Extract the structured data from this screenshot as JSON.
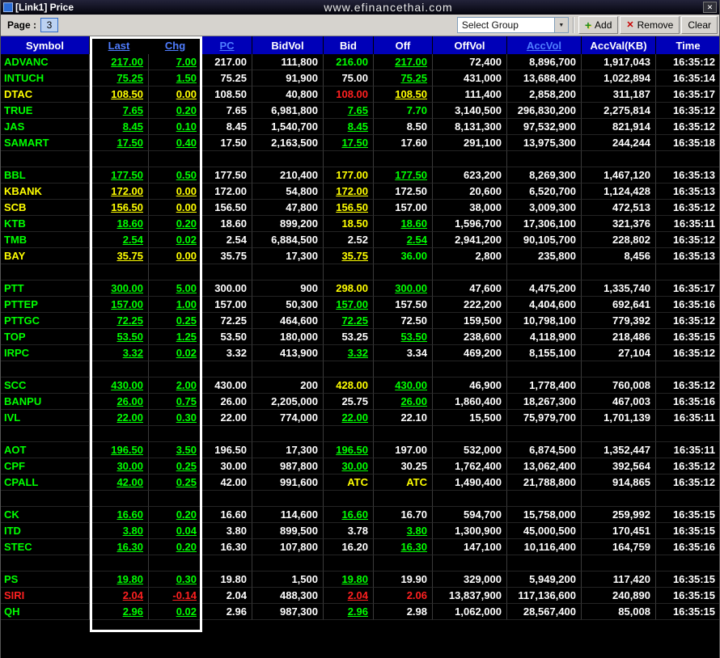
{
  "window": {
    "title": "[Link1] Price",
    "url": "www.efinancethai.com"
  },
  "icons": {
    "close": "✕",
    "dropdown": "▼",
    "add": "+",
    "remove": "✕"
  },
  "toolbar": {
    "page_label": "Page :",
    "page_value": "3",
    "group_placeholder": "Select Group",
    "add_label": "Add",
    "remove_label": "Remove",
    "clear_label": "Clear"
  },
  "colors": {
    "up": "#00ff00",
    "unchanged": "#ffff00",
    "down": "#ff2020",
    "header_bg": "#0000b8",
    "header_link": "#4f7dff"
  },
  "table": {
    "columns": [
      "Symbol",
      "Last",
      "Chg",
      "PC",
      "BidVol",
      "Bid",
      "Off",
      "OffVol",
      "AccVol",
      "AccVal(KB)",
      "Time"
    ],
    "rows": [
      {
        "symbol": "ADVANC",
        "trend": "up",
        "last": "217.00",
        "chg": "7.00",
        "pc": "217.00",
        "bidvol": "111,800",
        "bid": "216.00",
        "bid_c": "up",
        "bid_u": false,
        "off": "217.00",
        "off_c": "up",
        "off_u": true,
        "offvol": "72,400",
        "accvol": "8,896,700",
        "accval": "1,917,043",
        "time": "16:35:12"
      },
      {
        "symbol": "INTUCH",
        "trend": "up",
        "last": "75.25",
        "chg": "1.50",
        "pc": "75.25",
        "bidvol": "91,900",
        "bid": "75.00",
        "bid_c": "white",
        "bid_u": false,
        "off": "75.25",
        "off_c": "up",
        "off_u": true,
        "offvol": "431,000",
        "accvol": "13,688,400",
        "accval": "1,022,894",
        "time": "16:35:14"
      },
      {
        "symbol": "DTAC",
        "trend": "flat",
        "last": "108.50",
        "chg": "0.00",
        "pc": "108.50",
        "bidvol": "40,800",
        "bid": "108.00",
        "bid_c": "down",
        "bid_u": false,
        "off": "108.50",
        "off_c": "flat",
        "off_u": true,
        "offvol": "111,400",
        "accvol": "2,858,200",
        "accval": "311,187",
        "time": "16:35:17"
      },
      {
        "symbol": "TRUE",
        "trend": "up",
        "last": "7.65",
        "chg": "0.20",
        "pc": "7.65",
        "bidvol": "6,981,800",
        "bid": "7.65",
        "bid_c": "up",
        "bid_u": true,
        "off": "7.70",
        "off_c": "up",
        "off_u": false,
        "offvol": "3,140,500",
        "accvol": "296,830,200",
        "accval": "2,275,814",
        "time": "16:35:12"
      },
      {
        "symbol": "JAS",
        "trend": "up",
        "last": "8.45",
        "chg": "0.10",
        "pc": "8.45",
        "bidvol": "1,540,700",
        "bid": "8.45",
        "bid_c": "up",
        "bid_u": true,
        "off": "8.50",
        "off_c": "white",
        "off_u": false,
        "offvol": "8,131,300",
        "accvol": "97,532,900",
        "accval": "821,914",
        "time": "16:35:12"
      },
      {
        "symbol": "SAMART",
        "trend": "up",
        "last": "17.50",
        "chg": "0.40",
        "pc": "17.50",
        "bidvol": "2,163,500",
        "bid": "17.50",
        "bid_c": "up",
        "bid_u": true,
        "off": "17.60",
        "off_c": "white",
        "off_u": false,
        "offvol": "291,100",
        "accvol": "13,975,300",
        "accval": "244,244",
        "time": "16:35:18"
      },
      {
        "spacer": true
      },
      {
        "symbol": "BBL",
        "trend": "up",
        "last": "177.50",
        "chg": "0.50",
        "pc": "177.50",
        "bidvol": "210,400",
        "bid": "177.00",
        "bid_c": "flat",
        "bid_u": false,
        "off": "177.50",
        "off_c": "up",
        "off_u": true,
        "offvol": "623,200",
        "accvol": "8,269,300",
        "accval": "1,467,120",
        "time": "16:35:13"
      },
      {
        "symbol": "KBANK",
        "trend": "flat",
        "last": "172.00",
        "chg": "0.00",
        "pc": "172.00",
        "bidvol": "54,800",
        "bid": "172.00",
        "bid_c": "flat",
        "bid_u": true,
        "off": "172.50",
        "off_c": "white",
        "off_u": false,
        "offvol": "20,600",
        "accvol": "6,520,700",
        "accval": "1,124,428",
        "time": "16:35:13"
      },
      {
        "symbol": "SCB",
        "trend": "flat",
        "last": "156.50",
        "chg": "0.00",
        "pc": "156.50",
        "bidvol": "47,800",
        "bid": "156.50",
        "bid_c": "flat",
        "bid_u": true,
        "off": "157.00",
        "off_c": "white",
        "off_u": false,
        "offvol": "38,000",
        "accvol": "3,009,300",
        "accval": "472,513",
        "time": "16:35:12"
      },
      {
        "symbol": "KTB",
        "trend": "up",
        "last": "18.60",
        "chg": "0.20",
        "pc": "18.60",
        "bidvol": "899,200",
        "bid": "18.50",
        "bid_c": "flat",
        "bid_u": false,
        "off": "18.60",
        "off_c": "up",
        "off_u": true,
        "offvol": "1,596,700",
        "accvol": "17,306,100",
        "accval": "321,376",
        "time": "16:35:11"
      },
      {
        "symbol": "TMB",
        "trend": "up",
        "last": "2.54",
        "chg": "0.02",
        "pc": "2.54",
        "bidvol": "6,884,500",
        "bid": "2.52",
        "bid_c": "white",
        "bid_u": false,
        "off": "2.54",
        "off_c": "up",
        "off_u": true,
        "offvol": "2,941,200",
        "accvol": "90,105,700",
        "accval": "228,802",
        "time": "16:35:12"
      },
      {
        "symbol": "BAY",
        "trend": "flat",
        "last": "35.75",
        "chg": "0.00",
        "pc": "35.75",
        "bidvol": "17,300",
        "bid": "35.75",
        "bid_c": "flat",
        "bid_u": true,
        "off": "36.00",
        "off_c": "up",
        "off_u": false,
        "offvol": "2,800",
        "accvol": "235,800",
        "accval": "8,456",
        "time": "16:35:13"
      },
      {
        "spacer": true
      },
      {
        "symbol": "PTT",
        "trend": "up",
        "last": "300.00",
        "chg": "5.00",
        "pc": "300.00",
        "bidvol": "900",
        "bid": "298.00",
        "bid_c": "flat",
        "bid_u": false,
        "off": "300.00",
        "off_c": "up",
        "off_u": true,
        "offvol": "47,600",
        "accvol": "4,475,200",
        "accval": "1,335,740",
        "time": "16:35:17"
      },
      {
        "symbol": "PTTEP",
        "trend": "up",
        "last": "157.00",
        "chg": "1.00",
        "pc": "157.00",
        "bidvol": "50,300",
        "bid": "157.00",
        "bid_c": "up",
        "bid_u": true,
        "off": "157.50",
        "off_c": "white",
        "off_u": false,
        "offvol": "222,200",
        "accvol": "4,404,600",
        "accval": "692,641",
        "time": "16:35:16"
      },
      {
        "symbol": "PTTGC",
        "trend": "up",
        "last": "72.25",
        "chg": "0.25",
        "pc": "72.25",
        "bidvol": "464,600",
        "bid": "72.25",
        "bid_c": "up",
        "bid_u": true,
        "off": "72.50",
        "off_c": "white",
        "off_u": false,
        "offvol": "159,500",
        "accvol": "10,798,100",
        "accval": "779,392",
        "time": "16:35:12"
      },
      {
        "symbol": "TOP",
        "trend": "up",
        "last": "53.50",
        "chg": "1.25",
        "pc": "53.50",
        "bidvol": "180,000",
        "bid": "53.25",
        "bid_c": "white",
        "bid_u": false,
        "off": "53.50",
        "off_c": "up",
        "off_u": true,
        "offvol": "238,600",
        "accvol": "4,118,900",
        "accval": "218,486",
        "time": "16:35:15"
      },
      {
        "symbol": "IRPC",
        "trend": "up",
        "last": "3.32",
        "chg": "0.02",
        "pc": "3.32",
        "bidvol": "413,900",
        "bid": "3.32",
        "bid_c": "up",
        "bid_u": true,
        "off": "3.34",
        "off_c": "white",
        "off_u": false,
        "offvol": "469,200",
        "accvol": "8,155,100",
        "accval": "27,104",
        "time": "16:35:12"
      },
      {
        "spacer": true
      },
      {
        "symbol": "SCC",
        "trend": "up",
        "last": "430.00",
        "chg": "2.00",
        "pc": "430.00",
        "bidvol": "200",
        "bid": "428.00",
        "bid_c": "flat",
        "bid_u": false,
        "off": "430.00",
        "off_c": "up",
        "off_u": true,
        "offvol": "46,900",
        "accvol": "1,778,400",
        "accval": "760,008",
        "time": "16:35:12"
      },
      {
        "symbol": "BANPU",
        "trend": "up",
        "last": "26.00",
        "chg": "0.75",
        "pc": "26.00",
        "bidvol": "2,205,000",
        "bid": "25.75",
        "bid_c": "white",
        "bid_u": false,
        "off": "26.00",
        "off_c": "up",
        "off_u": true,
        "offvol": "1,860,400",
        "accvol": "18,267,300",
        "accval": "467,003",
        "time": "16:35:16"
      },
      {
        "symbol": "IVL",
        "trend": "up",
        "last": "22.00",
        "chg": "0.30",
        "pc": "22.00",
        "bidvol": "774,000",
        "bid": "22.00",
        "bid_c": "up",
        "bid_u": true,
        "off": "22.10",
        "off_c": "white",
        "off_u": false,
        "offvol": "15,500",
        "accvol": "75,979,700",
        "accval": "1,701,139",
        "time": "16:35:11"
      },
      {
        "spacer": true
      },
      {
        "symbol": "AOT",
        "trend": "up",
        "last": "196.50",
        "chg": "3.50",
        "pc": "196.50",
        "bidvol": "17,300",
        "bid": "196.50",
        "bid_c": "up",
        "bid_u": true,
        "off": "197.00",
        "off_c": "white",
        "off_u": false,
        "offvol": "532,000",
        "accvol": "6,874,500",
        "accval": "1,352,447",
        "time": "16:35:11"
      },
      {
        "symbol": "CPF",
        "trend": "up",
        "last": "30.00",
        "chg": "0.25",
        "pc": "30.00",
        "bidvol": "987,800",
        "bid": "30.00",
        "bid_c": "up",
        "bid_u": true,
        "off": "30.25",
        "off_c": "white",
        "off_u": false,
        "offvol": "1,762,400",
        "accvol": "13,062,400",
        "accval": "392,564",
        "time": "16:35:12"
      },
      {
        "symbol": "CPALL",
        "trend": "up",
        "last": "42.00",
        "chg": "0.25",
        "pc": "42.00",
        "bidvol": "991,600",
        "bid": "ATC",
        "bid_c": "flat",
        "bid_u": false,
        "off": "ATC",
        "off_c": "flat",
        "off_u": false,
        "offvol": "1,490,400",
        "accvol": "21,788,800",
        "accval": "914,865",
        "time": "16:35:12"
      },
      {
        "spacer": true
      },
      {
        "symbol": "CK",
        "trend": "up",
        "last": "16.60",
        "chg": "0.20",
        "pc": "16.60",
        "bidvol": "114,600",
        "bid": "16.60",
        "bid_c": "up",
        "bid_u": true,
        "off": "16.70",
        "off_c": "white",
        "off_u": false,
        "offvol": "594,700",
        "accvol": "15,758,000",
        "accval": "259,992",
        "time": "16:35:15"
      },
      {
        "symbol": "ITD",
        "trend": "up",
        "last": "3.80",
        "chg": "0.04",
        "pc": "3.80",
        "bidvol": "899,500",
        "bid": "3.78",
        "bid_c": "white",
        "bid_u": false,
        "off": "3.80",
        "off_c": "up",
        "off_u": true,
        "offvol": "1,300,900",
        "accvol": "45,000,500",
        "accval": "170,451",
        "time": "16:35:15"
      },
      {
        "symbol": "STEC",
        "trend": "up",
        "last": "16.30",
        "chg": "0.20",
        "pc": "16.30",
        "bidvol": "107,800",
        "bid": "16.20",
        "bid_c": "white",
        "bid_u": false,
        "off": "16.30",
        "off_c": "up",
        "off_u": true,
        "offvol": "147,100",
        "accvol": "10,116,400",
        "accval": "164,759",
        "time": "16:35:16"
      },
      {
        "spacer": true
      },
      {
        "symbol": "PS",
        "trend": "up",
        "last": "19.80",
        "chg": "0.30",
        "pc": "19.80",
        "bidvol": "1,500",
        "bid": "19.80",
        "bid_c": "up",
        "bid_u": true,
        "off": "19.90",
        "off_c": "white",
        "off_u": false,
        "offvol": "329,000",
        "accvol": "5,949,200",
        "accval": "117,420",
        "time": "16:35:15"
      },
      {
        "symbol": "SIRI",
        "trend": "down",
        "last": "2.04",
        "chg": "-0.14",
        "pc": "2.04",
        "bidvol": "488,300",
        "bid": "2.04",
        "bid_c": "down",
        "bid_u": true,
        "off": "2.06",
        "off_c": "down",
        "off_u": false,
        "offvol": "13,837,900",
        "accvol": "117,136,600",
        "accval": "240,890",
        "time": "16:35:15"
      },
      {
        "symbol": "QH",
        "trend": "up",
        "last": "2.96",
        "chg": "0.02",
        "pc": "2.96",
        "bidvol": "987,300",
        "bid": "2.96",
        "bid_c": "up",
        "bid_u": true,
        "off": "2.98",
        "off_c": "white",
        "off_u": false,
        "offvol": "1,062,000",
        "accvol": "28,567,400",
        "accval": "85,008",
        "time": "16:35:15"
      }
    ]
  }
}
